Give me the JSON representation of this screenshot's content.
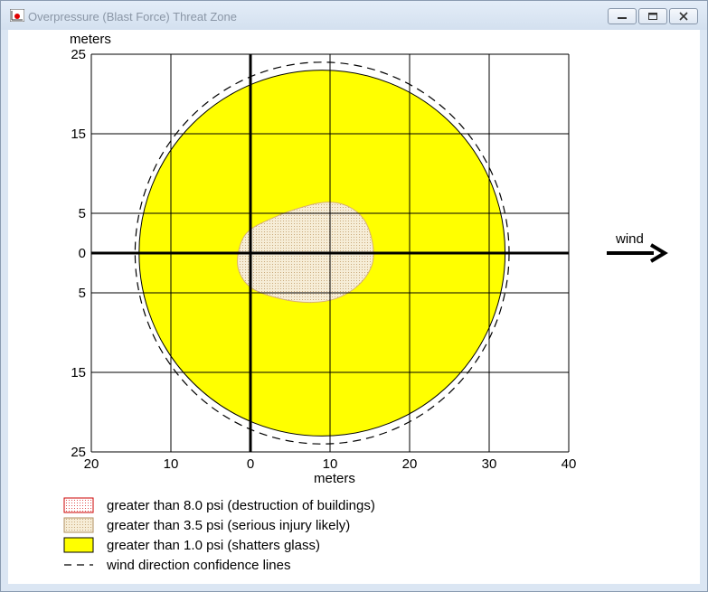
{
  "window": {
    "title": "Overpressure (Blast Force) Threat Zone",
    "controls": {
      "minimize": "minimize-icon",
      "maximize": "restore-icon",
      "close": "close-icon"
    }
  },
  "chart_data": {
    "type": "area",
    "ylabel": "meters",
    "xlabel": "meters",
    "xlim": [
      -20,
      40
    ],
    "ylim": [
      -25,
      25
    ],
    "x_ticks": [
      -20,
      -10,
      0,
      10,
      20,
      30,
      40
    ],
    "x_tick_labels": [
      "20",
      "10",
      "0",
      "10",
      "20",
      "30",
      "40"
    ],
    "y_ticks": [
      25,
      15,
      5,
      0,
      -5,
      -15,
      -25
    ],
    "y_tick_labels": [
      "25",
      "15",
      "5",
      "0",
      "5",
      "15",
      "25"
    ],
    "grid": true,
    "colors": {
      "zone_3_5": "#f3e8cf",
      "zone_1_0": "#ffff00",
      "zone_8_0_border": "#ff0000",
      "axis": "#000000"
    },
    "zones": [
      {
        "threshold_psi": 1.0,
        "shape": "ellipse",
        "center_x": 9.0,
        "center_y": 0.0,
        "radius_x": 23.0,
        "radius_y": 23.0
      },
      {
        "threshold_psi": 3.5,
        "shape": "polygon",
        "points": [
          [
            -1.5,
            0.2
          ],
          [
            -0.3,
            2.7
          ],
          [
            3.0,
            4.5
          ],
          [
            6.6,
            5.8
          ],
          [
            9.6,
            6.4
          ],
          [
            12.2,
            5.9
          ],
          [
            14.2,
            4.3
          ],
          [
            15.3,
            1.5
          ],
          [
            15.3,
            -1.4
          ],
          [
            13.6,
            -4.0
          ],
          [
            10.8,
            -5.7
          ],
          [
            7.6,
            -6.2
          ],
          [
            4.0,
            -5.8
          ],
          [
            0.3,
            -4.5
          ],
          [
            -1.4,
            -2.4
          ]
        ]
      }
    ],
    "confidence_lines": {
      "center_x": 9.0,
      "center_y": 0.0,
      "radius_x": 23.5,
      "radius_y": 24.0
    },
    "legend": [
      {
        "label": "greater than 8.0 psi (destruction of buildings)",
        "swatch": "dotted-red"
      },
      {
        "label": "greater than 3.5 psi (serious injury likely)",
        "swatch": "dotted-tan"
      },
      {
        "label": "greater than 1.0 psi (shatters glass)",
        "swatch": "yellow"
      },
      {
        "label": "wind direction confidence lines",
        "swatch": "dashed-line"
      }
    ],
    "wind_label": "wind"
  }
}
